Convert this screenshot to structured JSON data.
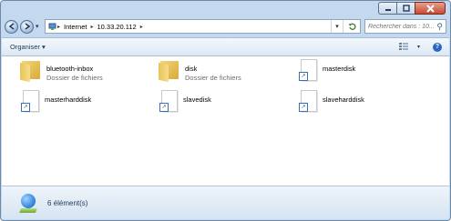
{
  "window": {
    "caption_buttons": [
      "minimize",
      "maximize",
      "close"
    ]
  },
  "addressbar": {
    "breadcrumbs": [
      "Internet",
      "10.33.20.112"
    ]
  },
  "search": {
    "placeholder": "Rechercher dans : 10..."
  },
  "toolbar": {
    "organise_label": "Organiser ▾"
  },
  "items": [
    {
      "name": "bluetooth-inbox",
      "type": "Dossier de fichiers",
      "icon": "folder-icon"
    },
    {
      "name": "disk",
      "type": "Dossier de fichiers",
      "icon": "folder-icon"
    },
    {
      "name": "masterdisk",
      "type": "",
      "icon": "shortcut-icon"
    },
    {
      "name": "masterharddisk",
      "type": "",
      "icon": "shortcut-icon"
    },
    {
      "name": "slavedisk",
      "type": "",
      "icon": "shortcut-icon"
    },
    {
      "name": "slaveharddisk",
      "type": "",
      "icon": "shortcut-icon"
    }
  ],
  "statusbar": {
    "text": "6 élément(s)"
  },
  "colors": {
    "frame": "#c4d8ee",
    "close_button": "#c74a32",
    "help_button": "#2a67c2"
  }
}
